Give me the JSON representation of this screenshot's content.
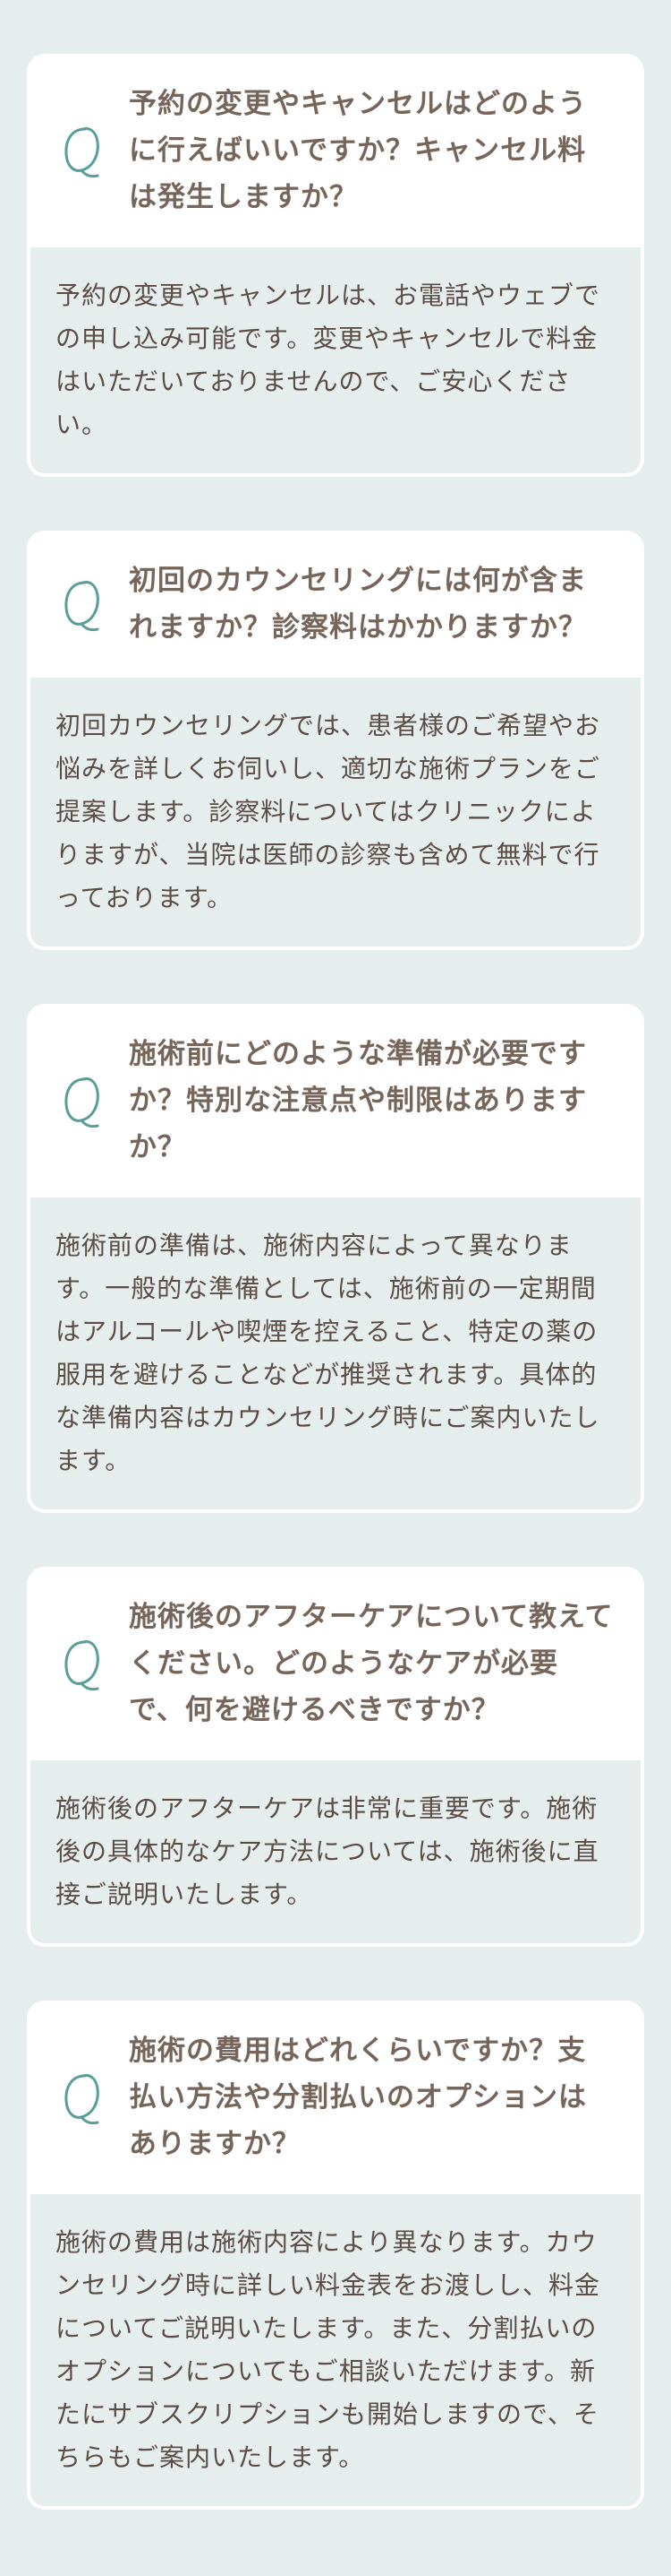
{
  "colors": {
    "page_background": "#e5eeed",
    "card_background": "#ffffff",
    "question_text": "#76655b",
    "answer_text": "#5b4d45",
    "q_icon": "#5a9e9a"
  },
  "faq": {
    "icon": "q-letter-icon",
    "items": [
      {
        "question": "予約の変更やキャンセルはどのように行えばいいですか？キャンセル料は発生しますか？",
        "answer": "予約の変更やキャンセルは、お電話やウェブでの申し込み可能です。変更やキャンセルで料金はいただいておりませんので、ご安心ください。"
      },
      {
        "question": "初回のカウンセリングには何が含まれますか？診察料はかかりますか？",
        "answer": "初回カウンセリングでは、患者様のご希望やお悩みを詳しくお伺いし、適切な施術プランをご提案します。診察料についてはクリニックによりますが、当院は医師の診察も含めて無料で行っております。"
      },
      {
        "question": "施術前にどのような準備が必要ですか？特別な注意点や制限はありますか？",
        "answer": "施術前の準備は、施術内容によって異なります。一般的な準備としては、施術前の一定期間はアルコールや喫煙を控えること、特定の薬の服用を避けることなどが推奨されます。具体的な準備内容はカウンセリング時にご案内いたします。"
      },
      {
        "question": "施術後のアフターケアについて教えてください。どのようなケアが必要で、何を避けるべきですか？",
        "answer": "施術後のアフターケアは非常に重要です。施術後の具体的なケア方法については、施術後に直接ご説明いたします。"
      },
      {
        "question": "施術の費用はどれくらいですか？支払い方法や分割払いのオプションはありますか？",
        "answer": "施術の費用は施術内容により異なります。カウンセリング時に詳しい料金表をお渡しし、料金についてご説明いたします。また、分割払いのオプションについてもご相談いただけます。新たにサブスクリプションも開始しますので、そちらもご案内いたします。"
      }
    ]
  }
}
